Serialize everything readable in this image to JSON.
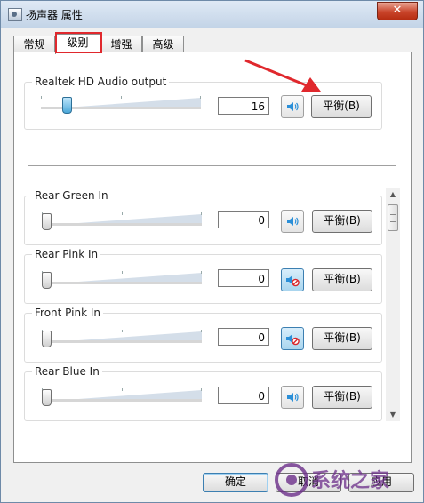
{
  "window": {
    "title": "扬声器 属性",
    "close_label": "✕"
  },
  "tabs": [
    {
      "label": "常规"
    },
    {
      "label": "级别"
    },
    {
      "label": "增强"
    },
    {
      "label": "高级"
    }
  ],
  "main_device": {
    "label": "Realtek HD Audio output",
    "value": "16",
    "level": 16,
    "muted": false,
    "balance_label": "平衡(B)"
  },
  "channels": [
    {
      "label": "Rear Green In",
      "value": "0",
      "muted": false,
      "balance_label": "平衡(B)"
    },
    {
      "label": "Rear Pink In",
      "value": "0",
      "muted": true,
      "balance_label": "平衡(B)"
    },
    {
      "label": "Front Pink In",
      "value": "0",
      "muted": true,
      "balance_label": "平衡(B)"
    },
    {
      "label": "Rear Blue In",
      "value": "0",
      "muted": false,
      "balance_label": "平衡(B)"
    }
  ],
  "footer": {
    "ok_label": "确定",
    "cancel_label": "取消",
    "apply_label": "应用"
  },
  "watermark": {
    "text": "系统之家"
  },
  "colors": {
    "highlight_red": "#e0282d",
    "speaker_blue": "#2a8fd8"
  }
}
